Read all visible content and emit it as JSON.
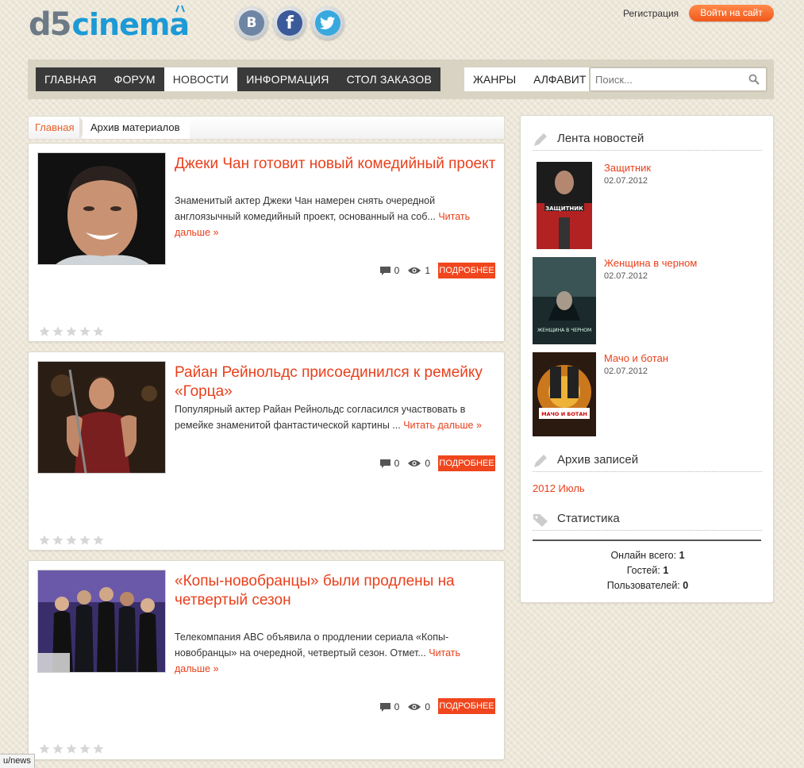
{
  "header": {
    "logo_part1": "d5",
    "logo_part2": "cinema",
    "social": [
      {
        "name": "vk",
        "glyph": "B"
      },
      {
        "name": "facebook",
        "glyph": "f"
      },
      {
        "name": "twitter",
        "glyph": "t"
      }
    ],
    "register_label": "Регистрация",
    "login_label": "Войти на сайт"
  },
  "nav": {
    "main": [
      "ГЛАВНАЯ",
      "ФОРУМ",
      "НОВОСТИ",
      "ИНФОРМАЦИЯ",
      "СТОЛ ЗАКАЗОВ"
    ],
    "active": "НОВОСТИ",
    "secondary": [
      "ЖАНРЫ",
      "АЛФАВИТ"
    ],
    "search_placeholder": "Поиск..."
  },
  "breadcrumb": {
    "home": "Главная",
    "current": "Архив материалов"
  },
  "posts": [
    {
      "title": "Джеки Чан готовит новый комедийный проект",
      "excerpt": "Знаменитый актер Джеки Чан намерен снять очередной англоязычный комедийный проект, основанный на соб...",
      "read_more": "Читать дальше »",
      "comments": "0",
      "views": "1",
      "button": "ПОДРОБНЕЕ",
      "rating": 0
    },
    {
      "title": "Райан Рейнольдс присоединился к ремейку «Горца»",
      "excerpt": "Популярный актер Райан Рейнольдс согласился участвовать в ремейке знаменитой фантастической картины ...",
      "read_more": "Читать дальше »",
      "comments": "0",
      "views": "0",
      "button": "ПОДРОБНЕЕ",
      "rating": 0
    },
    {
      "title": "«Копы-новобранцы» были продлены на четвертый сезон",
      "excerpt": "Телекомпания ABC объявила о продлении сериала «Копы-новобранцы» на очередной, четвертый сезон. Отмет...",
      "read_more": "Читать дальше »",
      "comments": "0",
      "views": "0",
      "button": "ПОДРОБНЕЕ",
      "rating": 0
    }
  ],
  "sidebar": {
    "news_feed_title": "Лента новостей",
    "feed": [
      {
        "title": "Защитник",
        "date": "02.07.2012",
        "poster_text": "ЗАЩИТНИК"
      },
      {
        "title": "Женщина в черном",
        "date": "02.07.2012",
        "poster_text": "ЖЕНЩИНА В ЧЕРНОМ"
      },
      {
        "title": "Мачо и ботан",
        "date": "02.07.2012",
        "poster_text": "МАЧО И БОТАН"
      }
    ],
    "archive_title": "Архив записей",
    "archive_link": "2012 Июль",
    "stats_title": "Статистика",
    "stats": {
      "online_label": "Онлайн всего:",
      "online_value": "1",
      "guests_label": "Гостей:",
      "guests_value": "1",
      "users_label": "Пользователей:",
      "users_value": "0"
    }
  },
  "status_bar": {
    "url": "u/news"
  }
}
